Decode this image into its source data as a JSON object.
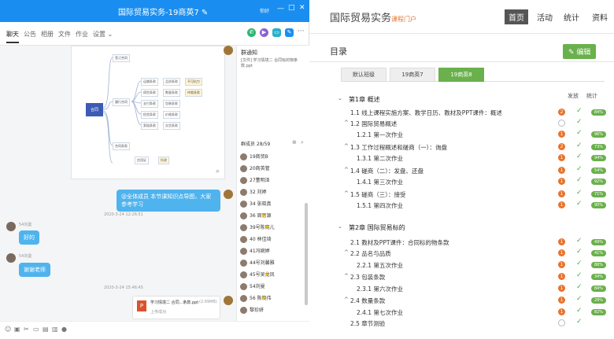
{
  "left": {
    "title": "国际贸易实务-19商英7 ✎",
    "window_user": "你好",
    "tabs": [
      "聊天",
      "公告",
      "相册",
      "文件",
      "作业",
      "设置 ⌄"
    ],
    "notice_title": "群通知",
    "notice_text": "[文件] 学习情境二 合同标的物条款.ppt",
    "members_title": "群成员 28/59",
    "members": [
      {
        "name": "19商贸B",
        "star": false
      },
      {
        "name": "20商英管",
        "star": false
      },
      {
        "name": "27董明泽",
        "star": false
      },
      {
        "name": "32 刘婷",
        "star": false
      },
      {
        "name": "34 张晓真",
        "star": false
      },
      {
        "name": "36 周思源",
        "star": true
      },
      {
        "name": "39号陈晓儿",
        "star": true
      },
      {
        "name": "40 林佳琦",
        "star": false
      },
      {
        "name": "41冯婉婷",
        "star": false
      },
      {
        "name": "44号刘馨雅",
        "star": false
      },
      {
        "name": "45号吴龙凤",
        "star": true
      },
      {
        "name": "54刘曼",
        "star": false
      },
      {
        "name": "56 陈晓伟",
        "star": true
      },
      {
        "name": "黎珍妍",
        "star": false
      }
    ],
    "teacher_msg": "@全体成员 本节课知识点导图，大家参考学习",
    "timestamp1": "2020-3-24 12:26:51",
    "student_name1": "54刘曼",
    "student_msg1": "好的",
    "student_name2": "54刘曼",
    "student_msg2": "谢谢老师",
    "timestamp2": "2020-3-24 15:46:45",
    "file_name": "学习情境二 合同...条款.ppt",
    "file_size": "(2.69MB)",
    "file_status": "上传成功",
    "mindmap_center": "合同",
    "mindmap_nodes": [
      "签订合同",
      "履行合同",
      "运输条款",
      "保险条款",
      "支付条款",
      "检验条款",
      "索赔条款",
      "品质条款",
      "数量条款",
      "包装条款",
      "价格条款",
      "交货条款",
      "不可抗力",
      "仲裁条款",
      "合同条款",
      "信用证",
      "托收"
    ]
  },
  "right": {
    "app_title": "国际贸易实务",
    "app_subtitle": "课程门户",
    "nav": [
      "首页",
      "活动",
      "统计",
      "资料"
    ],
    "section_title": "目录",
    "edit_label": "✎ 编辑",
    "class_tabs": [
      "默认班级",
      "19商英7",
      "19商英8"
    ],
    "col_publish": "发放",
    "col_stats": "统计",
    "rows": [
      {
        "label": "第1章  概述",
        "level": 0,
        "dot": "",
        "check": false,
        "pill": "",
        "circle": false
      },
      {
        "label": "1.1  线上课程实施方案、教学日历、教材及PPT课件：概述",
        "level": 1,
        "dot": "2",
        "check": true,
        "pill": "84%",
        "circle": false
      },
      {
        "label": "1.2  国际贸易概述",
        "level": 1,
        "dot": "",
        "check": true,
        "pill": "",
        "circle": true
      },
      {
        "label": "1.2.1  第一次作业",
        "level": 2,
        "dot": "1",
        "check": true,
        "pill": "96%",
        "circle": false
      },
      {
        "label": "1.3  工作过程概述和磋商（一）：询盘",
        "level": 1,
        "dot": "2",
        "check": true,
        "pill": "73%",
        "circle": false
      },
      {
        "label": "1.3.1  第二次作业",
        "level": 2,
        "dot": "1",
        "check": true,
        "pill": "94%",
        "circle": false
      },
      {
        "label": "1.4  磋商（二）：发盘、还盘",
        "level": 1,
        "dot": "1",
        "check": true,
        "pill": "54%",
        "circle": false
      },
      {
        "label": "1.4.1  第三次作业",
        "level": 2,
        "dot": "1",
        "check": true,
        "pill": "92%",
        "circle": false
      },
      {
        "label": "1.5  磋商（三）：接受",
        "level": 1,
        "dot": "1",
        "check": true,
        "pill": "71%",
        "circle": false
      },
      {
        "label": "1.5.1  第四次作业",
        "level": 2,
        "dot": "1",
        "check": true,
        "pill": "90%",
        "circle": false
      },
      {
        "label": "第2章  国际贸易标的",
        "level": 0,
        "dot": "",
        "check": false,
        "pill": "",
        "circle": false
      },
      {
        "label": "2.1  教材及PPT课件：合同标的物条款",
        "level": 1,
        "dot": "1",
        "check": true,
        "pill": "49%",
        "circle": false
      },
      {
        "label": "2.2  品名与品质",
        "level": 1,
        "dot": "1",
        "check": true,
        "pill": "41%",
        "circle": false
      },
      {
        "label": "2.2.1  第五次作业",
        "level": 2,
        "dot": "1",
        "check": true,
        "pill": "86%",
        "circle": false
      },
      {
        "label": "2.3  包装条款",
        "level": 1,
        "dot": "1",
        "check": true,
        "pill": "34%",
        "circle": false
      },
      {
        "label": "2.3.1  第六次作业",
        "level": 2,
        "dot": "1",
        "check": true,
        "pill": "84%",
        "circle": false
      },
      {
        "label": "2.4  数量条款",
        "level": 1,
        "dot": "1",
        "check": true,
        "pill": "29%",
        "circle": false
      },
      {
        "label": "2.4.1  第七次作业",
        "level": 2,
        "dot": "1",
        "check": true,
        "pill": "82%",
        "circle": false
      },
      {
        "label": "2.5  章节测验",
        "level": 1,
        "dot": "",
        "check": true,
        "pill": "",
        "circle": true
      }
    ]
  },
  "colors": {
    "titlebar": "#1a8ef0",
    "green": "#6ab04c",
    "orange": "#e8732c",
    "bubble": "#4fb3ee"
  }
}
